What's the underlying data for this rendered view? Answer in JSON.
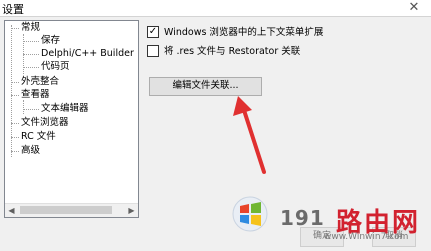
{
  "window": {
    "title": "设置",
    "close_glyph": "✕"
  },
  "tree": {
    "items": [
      {
        "label": "常规"
      },
      {
        "label": "保存"
      },
      {
        "label": "Delphi/C++ Builder"
      },
      {
        "label": "代码页"
      },
      {
        "label": "外壳整合"
      },
      {
        "label": "查看器"
      },
      {
        "label": "文本编辑器"
      },
      {
        "label": "文件浏览器"
      },
      {
        "label": "RC 文件"
      },
      {
        "label": "高级"
      }
    ],
    "scroll_left": "◀",
    "scroll_right": "▶"
  },
  "options": {
    "context_menu": {
      "label": "Windows 浏览器中的上下文菜单扩展",
      "checked": true,
      "check_glyph": "✓"
    },
    "res_assoc": {
      "label": "将 .res 文件与 Restorator 关联",
      "checked": false
    }
  },
  "edit_assoc_button": "编辑文件关联...",
  "annotation_color": "#e03030",
  "watermark": {
    "number": "191",
    "chinese": "路由网",
    "url": "www.Winwin7.com"
  },
  "footer": {
    "ok_partial": "确定",
    "cancel_partial": "取消"
  }
}
